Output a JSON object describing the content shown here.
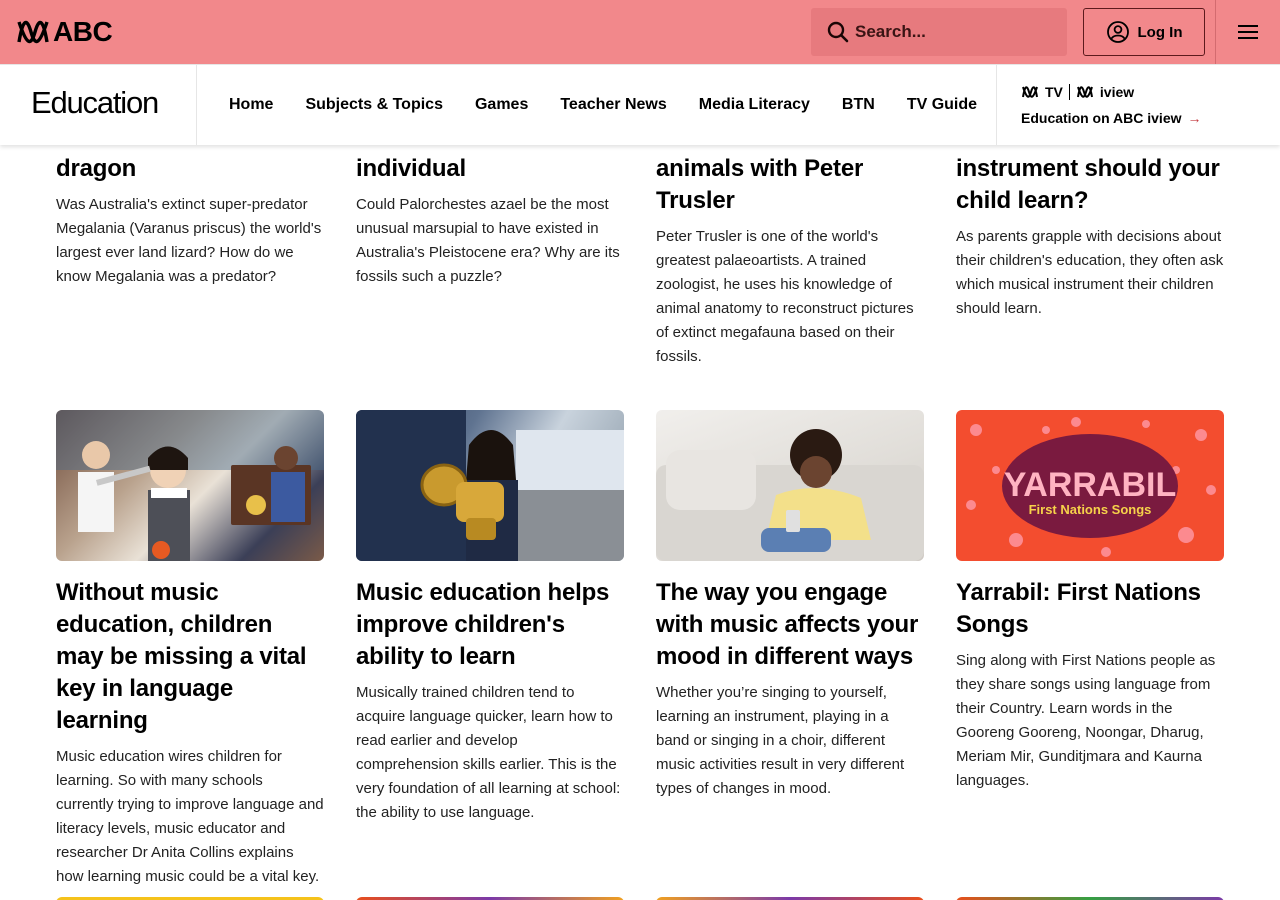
{
  "topbar": {
    "logo_text": "ABC",
    "search_placeholder": "Search...",
    "login_label": "Log In",
    "colors": {
      "background": "#f2888b",
      "search_bg": "#e77a7e"
    }
  },
  "navbar": {
    "section_title": "Education",
    "links": [
      "Home",
      "Subjects & Topics",
      "Games",
      "Teacher News",
      "Media Literacy",
      "BTN",
      "TV Guide"
    ],
    "promo": {
      "logo_tv": "TV",
      "logo_iview": "iview",
      "link_label": "Education on ABC iview"
    }
  },
  "row1": [
    {
      "title": "dragon",
      "desc": "Was Australia's extinct super-predator Megalania (Varanus priscus) the world's largest ever land lizard? How do we know Megalania was a predator?"
    },
    {
      "title": "individual",
      "desc": "Could Palorchestes azael be the most unusual marsupial to have existed in Australia's Pleistocene era? Why are its fossils such a puzzle?"
    },
    {
      "title": "animals with Peter Trusler",
      "desc": "Peter Trusler is one of the world's greatest palaeoartists. A trained zoologist, he uses his knowledge of animal anatomy to reconstruct pictures of extinct megafauna based on their fossils."
    },
    {
      "title": "instrument should your child learn?",
      "desc": "As parents grapple with decisions about their children's education, they often ask which musical instrument their children should learn."
    }
  ],
  "row2": [
    {
      "image": "children-with-instruments-classroom",
      "title": "Without music education, children may be missing a vital key in language learning",
      "desc": "Music education wires children for learning. So with many schools currently trying to improve language and literacy levels, music educator and researcher Dr Anita Collins explains how learning music could be a vital key."
    },
    {
      "image": "girl-holding-tuba",
      "title": "Music education helps improve children's ability to learn",
      "desc": "Musically trained children tend to acquire language quicker, learn how to read earlier and develop comprehension skills earlier. This is the very foundation of all learning at school: the ability to use language."
    },
    {
      "image": "girl-listening-music-on-couch",
      "title": "The way you engage with music affects your mood in different ways",
      "desc": "Whether you’re singing to yourself, learning an instrument, playing in a band or singing in a choir, different music activities result in very different types of changes in mood."
    },
    {
      "image": "yarrabil-logo",
      "image_text": "YARRABIL",
      "image_subtext": "First Nations Songs",
      "title": "Yarrabil: First Nations Songs",
      "desc": "Sing along with First Nations people as they share songs using language from their Country. Learn words in the Gooreng Gooreng, Noongar, Dharug, Meriam Mir, Gunditjmara and Kaurna languages."
    }
  ]
}
